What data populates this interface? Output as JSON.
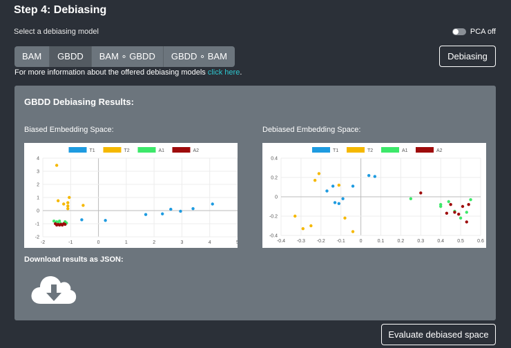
{
  "header": {
    "title": "Step 4: Debiasing"
  },
  "model_select": {
    "label": "Select a debiasing model",
    "options": [
      "BAM",
      "GBDD",
      "BAM ∘ GBDD",
      "GBDD ∘ BAM"
    ],
    "selected": "GBDD"
  },
  "pca_toggle": {
    "label": "PCA off",
    "state": "off"
  },
  "debias_button": "Debiasing",
  "info": {
    "text": "For more information about the offered debiasing models ",
    "link": "click here",
    "suffix": "."
  },
  "results": {
    "title": "GBDD Debiasing Results:",
    "biased_label": "Biased Embedding Space:",
    "debiased_label": "Debiased Embedding Space:",
    "download_label": "Download results as JSON:"
  },
  "evaluate_button": "Evaluate debiased space",
  "colors": {
    "T1": "#1e9be0",
    "T2": "#f5b800",
    "A1": "#3de86a",
    "A2": "#9e0b0b"
  },
  "chart_data": [
    {
      "type": "scatter",
      "title": "",
      "legend": [
        "T1",
        "T2",
        "A1",
        "A2"
      ],
      "legend_position": "top",
      "xlim": [
        -2,
        5
      ],
      "ylim": [
        -2,
        4
      ],
      "x_ticks": [
        "-2",
        "-1",
        "0",
        "1",
        "2",
        "3",
        "4",
        "5"
      ],
      "y_ticks": [
        "4",
        "3",
        "2",
        "1",
        "0",
        "-1",
        "-2"
      ],
      "grid": true,
      "series": [
        {
          "name": "T1",
          "points": [
            [
              -0.6,
              -0.7
            ],
            [
              0.25,
              -0.75
            ],
            [
              1.7,
              -0.3
            ],
            [
              2.3,
              -0.25
            ],
            [
              2.6,
              0.1
            ],
            [
              2.95,
              -0.05
            ],
            [
              3.4,
              0.15
            ],
            [
              4.1,
              0.5
            ]
          ]
        },
        {
          "name": "T2",
          "points": [
            [
              -1.5,
              3.45
            ],
            [
              -1.45,
              0.75
            ],
            [
              -1.25,
              0.5
            ],
            [
              -1.05,
              1.0
            ],
            [
              -1.1,
              0.6
            ],
            [
              -1.1,
              0.35
            ],
            [
              -1.1,
              0.15
            ],
            [
              -0.55,
              0.4
            ]
          ]
        },
        {
          "name": "A1",
          "points": [
            [
              -1.6,
              -0.8
            ],
            [
              -1.5,
              -0.85
            ],
            [
              -1.4,
              -0.8
            ],
            [
              -1.45,
              -0.95
            ],
            [
              -1.35,
              -1.0
            ],
            [
              -1.25,
              -1.0
            ],
            [
              -1.2,
              -0.85
            ],
            [
              -1.15,
              -0.95
            ]
          ]
        },
        {
          "name": "A2",
          "points": [
            [
              -1.55,
              -1.0
            ],
            [
              -1.5,
              -1.1
            ],
            [
              -1.45,
              -1.05
            ],
            [
              -1.4,
              -1.1
            ],
            [
              -1.35,
              -1.05
            ],
            [
              -1.3,
              -1.1
            ],
            [
              -1.25,
              -1.0
            ],
            [
              -1.2,
              -1.05
            ]
          ]
        }
      ]
    },
    {
      "type": "scatter",
      "title": "",
      "legend": [
        "T1",
        "T2",
        "A1",
        "A2"
      ],
      "legend_position": "top",
      "xlim": [
        -0.4,
        0.6
      ],
      "ylim": [
        -0.4,
        0.4
      ],
      "x_ticks": [
        "-0.4",
        "-0.3",
        "-0.2",
        "-0.1",
        "0",
        "0.1",
        "0.2",
        "0.3",
        "0.4",
        "0.5",
        "0.6"
      ],
      "y_ticks": [
        "0.4",
        "0.2",
        "0",
        "-0.2",
        "-0.4"
      ],
      "grid": true,
      "series": [
        {
          "name": "T1",
          "points": [
            [
              -0.17,
              0.06
            ],
            [
              -0.14,
              0.11
            ],
            [
              -0.04,
              0.11
            ],
            [
              0.04,
              0.22
            ],
            [
              0.07,
              0.21
            ],
            [
              -0.13,
              -0.06
            ],
            [
              -0.11,
              -0.07
            ],
            [
              -0.09,
              -0.02
            ]
          ]
        },
        {
          "name": "T2",
          "points": [
            [
              -0.33,
              -0.2
            ],
            [
              -0.29,
              -0.33
            ],
            [
              -0.25,
              -0.3
            ],
            [
              -0.23,
              0.17
            ],
            [
              -0.21,
              0.24
            ],
            [
              -0.11,
              0.12
            ],
            [
              -0.08,
              -0.22
            ],
            [
              -0.04,
              -0.36
            ]
          ]
        },
        {
          "name": "A1",
          "points": [
            [
              0.25,
              -0.02
            ],
            [
              0.4,
              -0.08
            ],
            [
              0.4,
              -0.1
            ],
            [
              0.44,
              -0.05
            ],
            [
              0.47,
              -0.15
            ],
            [
              0.5,
              -0.22
            ],
            [
              0.53,
              -0.16
            ],
            [
              0.55,
              -0.03
            ]
          ]
        },
        {
          "name": "A2",
          "points": [
            [
              0.3,
              0.04
            ],
            [
              0.43,
              -0.17
            ],
            [
              0.45,
              -0.08
            ],
            [
              0.47,
              -0.16
            ],
            [
              0.49,
              -0.18
            ],
            [
              0.51,
              -0.1
            ],
            [
              0.53,
              -0.26
            ],
            [
              0.54,
              -0.08
            ]
          ]
        }
      ]
    }
  ]
}
